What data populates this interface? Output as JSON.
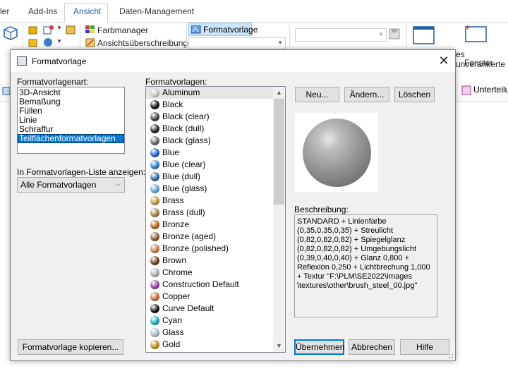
{
  "ribbon": {
    "tabs": [
      "ler",
      "Add-Ins",
      "Ansicht",
      "Daten-Management"
    ],
    "colormanager": "Farbmanager",
    "view_overrides": "Ansichtsüberschreibungen",
    "formatvorlage": "Formatvorlage",
    "unanchored": "es unverankerte",
    "window": "Fenster",
    "subdivision": "Unterteilun"
  },
  "dialog": {
    "title": "Formatvorlage",
    "type_label": "Formatvorlagenart:",
    "types": [
      "3D-Ansicht",
      "Bemaßung",
      "Füllen",
      "Linie",
      "Schraffur",
      "Teilflächenformatvorlagen"
    ],
    "selected_type_index": 5,
    "show_label": "In Formatvorlagen-Liste anzeigen:",
    "show_value": "Alle Formatvorlagen",
    "styles_label": "Formatvorlagen:",
    "styles": [
      {
        "name": "Aluminum",
        "color": "#c8c8c8"
      },
      {
        "name": "Black",
        "color": "#111111"
      },
      {
        "name": "Black (clear)",
        "color": "#444444"
      },
      {
        "name": "Black (dull)",
        "color": "#222222"
      },
      {
        "name": "Black (glass)",
        "color": "#666666"
      },
      {
        "name": "Blue",
        "color": "#1a5fc8"
      },
      {
        "name": "Blue (clear)",
        "color": "#2f78c8"
      },
      {
        "name": "Blue (dull)",
        "color": "#2c6ca6"
      },
      {
        "name": "Blue (glass)",
        "color": "#5aa0d8"
      },
      {
        "name": "Brass",
        "color": "#b8973a"
      },
      {
        "name": "Brass (dull)",
        "color": "#9a8040"
      },
      {
        "name": "Bronze",
        "color": "#b0601c"
      },
      {
        "name": "Bronze (aged)",
        "color": "#8a5a30"
      },
      {
        "name": "Bronze (polished)",
        "color": "#c07a3a"
      },
      {
        "name": "Brown",
        "color": "#6e3c1a"
      },
      {
        "name": "Chrome",
        "color": "#a8a8a8"
      },
      {
        "name": "Construction Default",
        "color": "#9a3aa8"
      },
      {
        "name": "Copper",
        "color": "#c06a3c"
      },
      {
        "name": "Curve Default",
        "color": "#151515"
      },
      {
        "name": "Cyan",
        "color": "#18a8b8"
      },
      {
        "name": "Glass",
        "color": "#a8b8c8"
      },
      {
        "name": "Gold",
        "color": "#b8901a"
      }
    ],
    "buttons": {
      "new": "Neu...",
      "edit": "Ändern...",
      "delete": "Löschen",
      "copy": "Formatvorlage kopieren...",
      "apply": "Übernehmen",
      "cancel": "Abbrechen",
      "help": "Hilfe"
    },
    "description_label": "Beschreibung:",
    "description": "STANDARD + Linienfarbe (0,35,0,35,0,35) + Streulicht (0,82,0,82,0,82) + Spiegelglanz (0,82,0,82,0,82) + Umgebungslicht (0,39,0,40,0,40) + Glanz 0,800 + Reflexion 0,250 + Lichtbrechung 1,000 + Textur \"F:\\PLM\\SE2022\\Images \\textures\\other\\brush_steel_00.jpg\""
  }
}
